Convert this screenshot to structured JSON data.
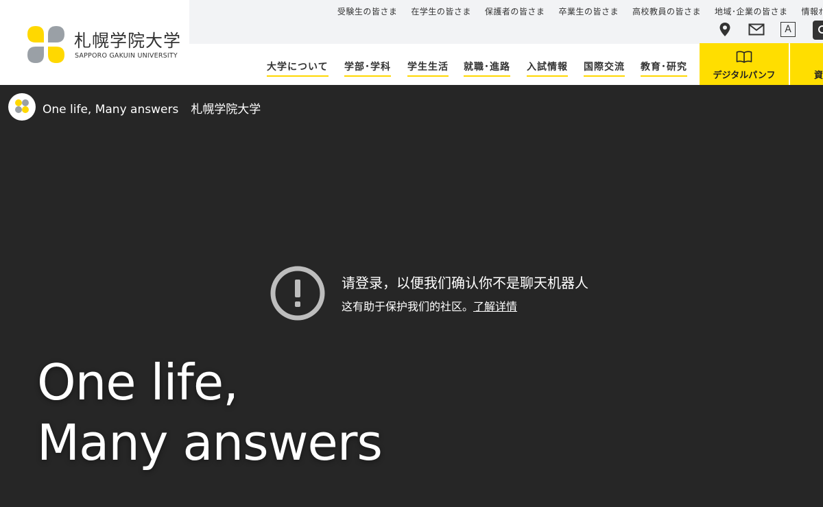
{
  "logo": {
    "ja": "札幌学院大学",
    "en": "SAPPORO GAKUIN UNIVERSITY"
  },
  "audience_links": [
    "受験生の皆さま",
    "在学生の皆さま",
    "保護者の皆さま",
    "卒業生の皆さま",
    "高校教員の皆さま",
    "地域･企業の皆さま",
    "情報ｵ"
  ],
  "utility": {
    "map_icon": "location-pin-icon",
    "mail_icon": "mail-icon",
    "text_size_label": "A",
    "search_icon": "search-icon"
  },
  "nav": [
    "大学について",
    "学部･学科",
    "学生生活",
    "就職･進路",
    "入試情報",
    "国際交流",
    "教育･研究"
  ],
  "pamphlet": {
    "label": "デジタルパンフ",
    "icon": "open-book-icon",
    "next_label": "資"
  },
  "video": {
    "channel_title": "One life, Many answers",
    "channel_name": "札幌学院大学",
    "notice_title": "请登录，以便我们确认你不是聊天机器人",
    "notice_sub": "这有助于保护我们的社区。",
    "notice_link": "了解详情",
    "hero_line1": "One life,",
    "hero_line2": "Many answers"
  },
  "colors": {
    "accent": "#ffde00",
    "video_bg": "#262626",
    "topbar_bg": "#f2f3f5"
  }
}
